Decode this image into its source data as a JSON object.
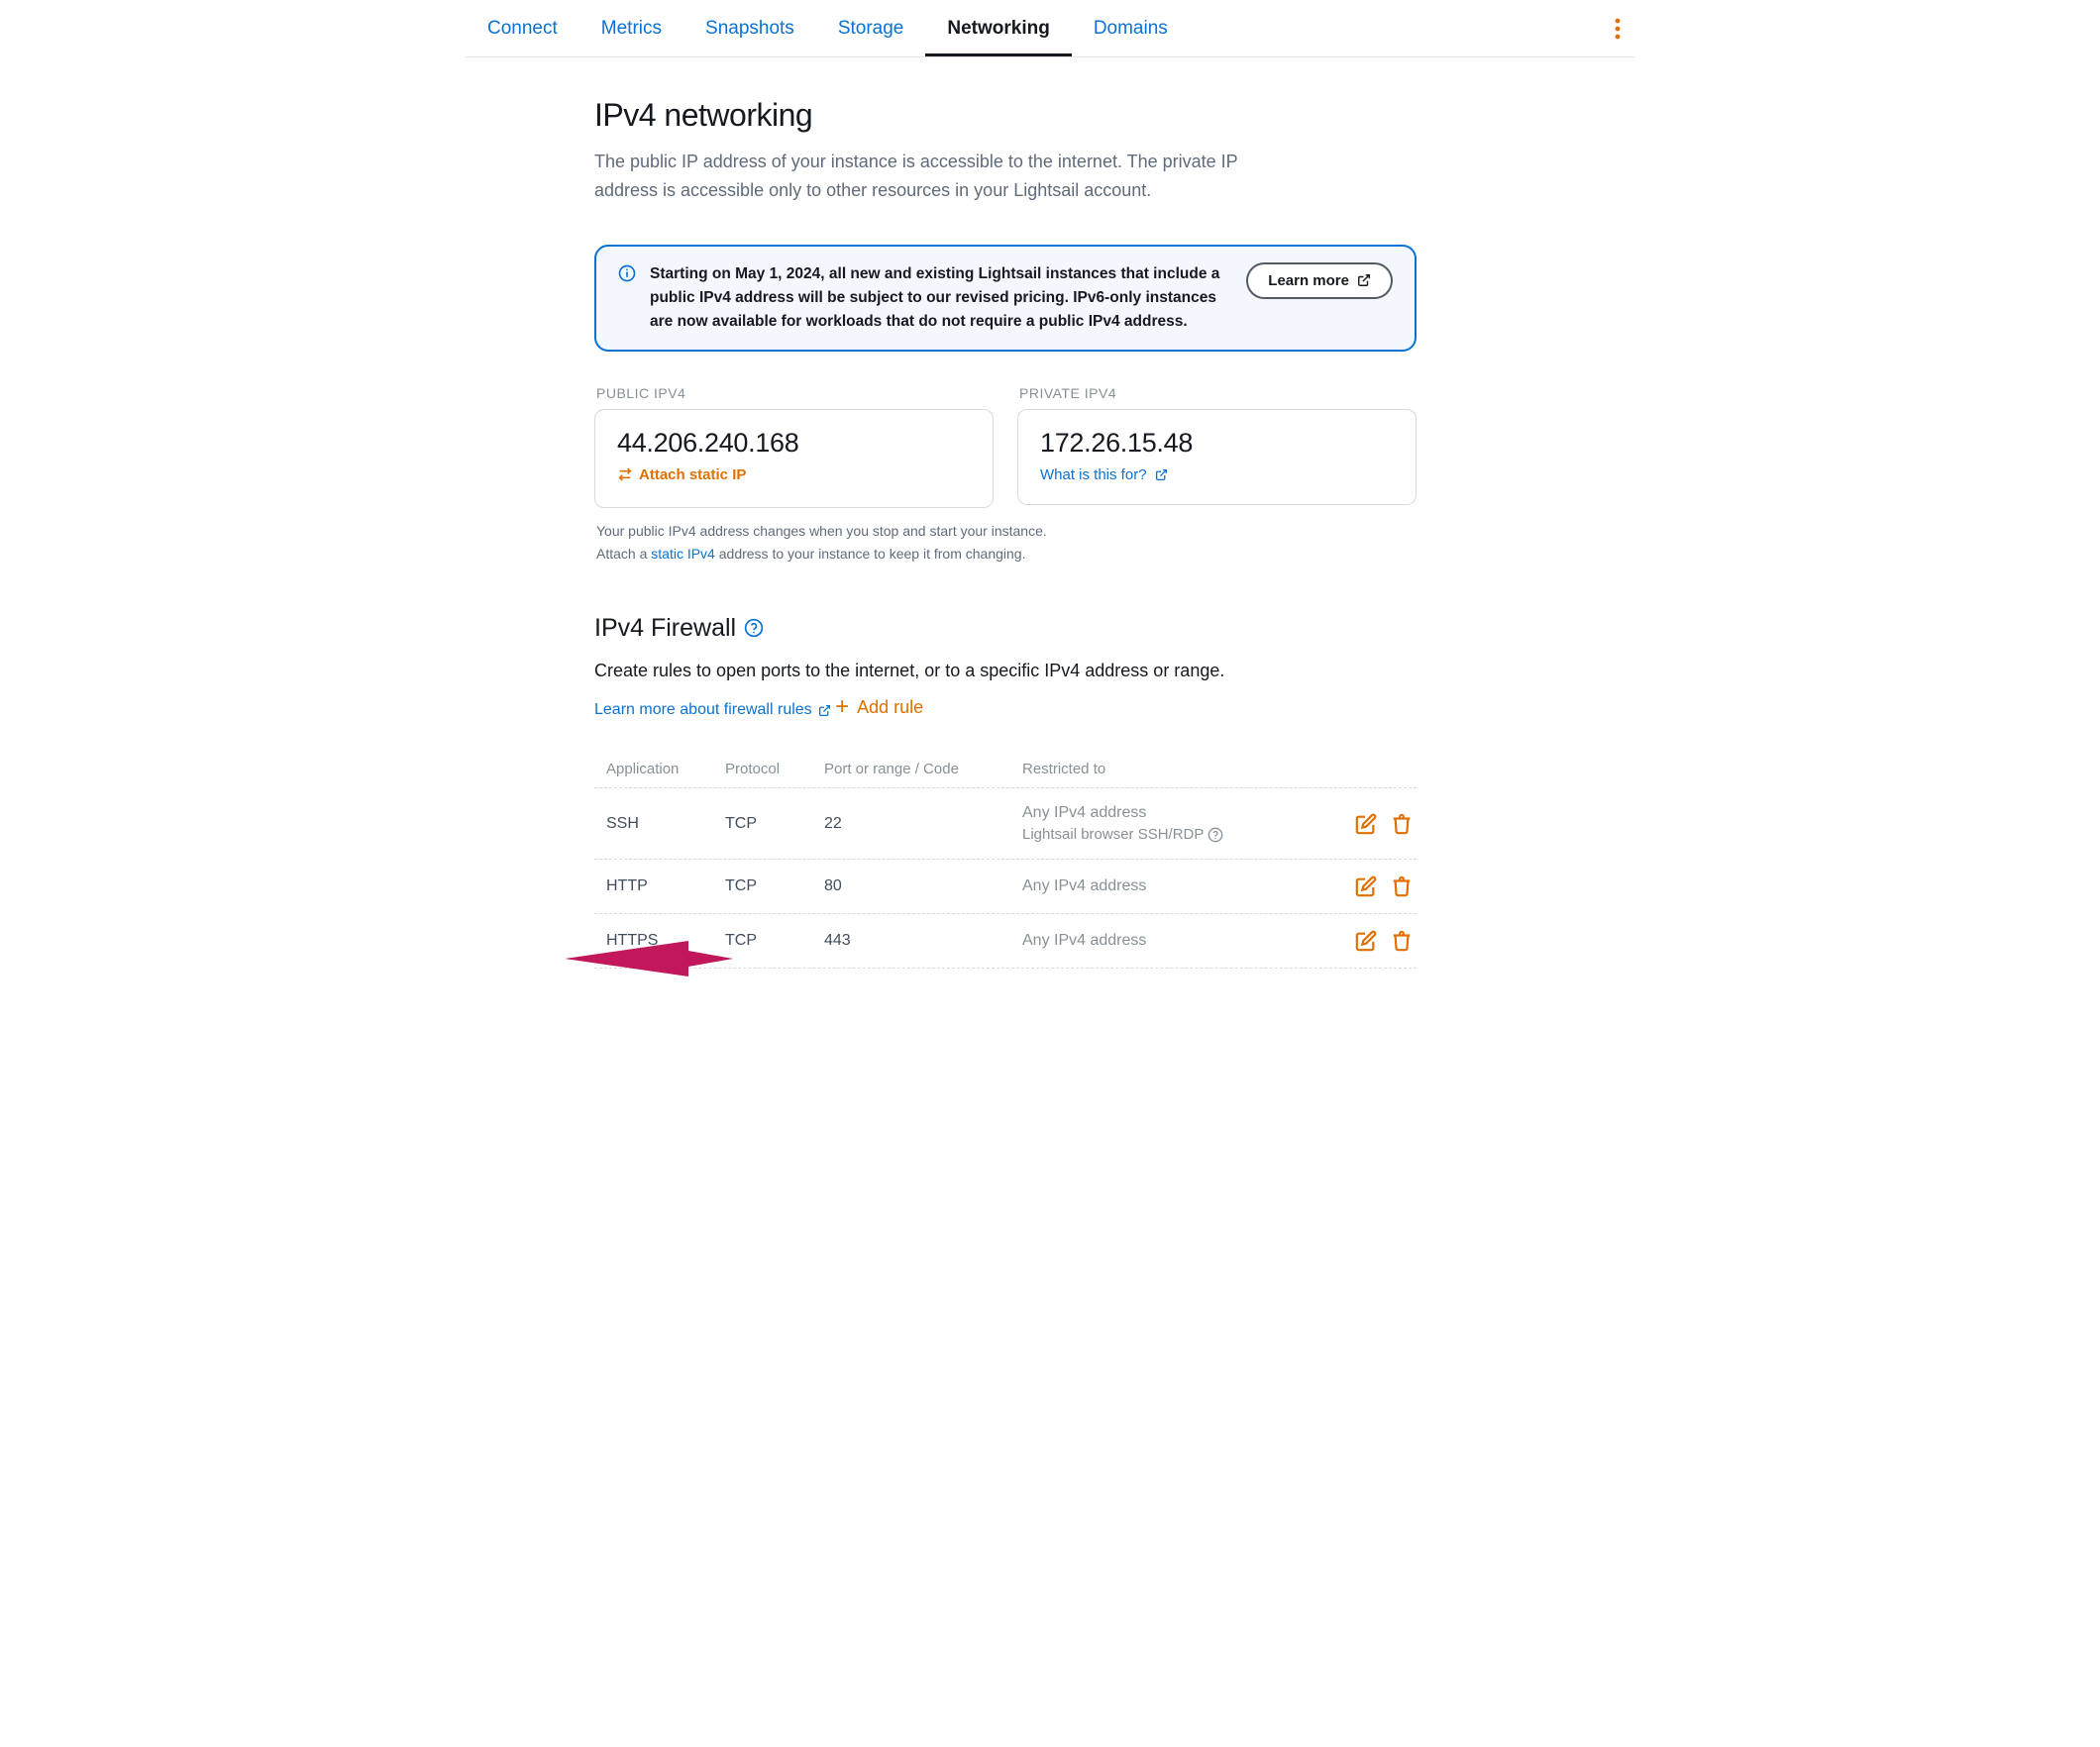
{
  "tabs": [
    "Connect",
    "Metrics",
    "Snapshots",
    "Storage",
    "Networking",
    "Domains"
  ],
  "active_tab_index": 4,
  "ipv4": {
    "heading": "IPv4 networking",
    "subtitle": "The public IP address of your instance is accessible to the internet. The private IP address is accessible only to other resources in your Lightsail account."
  },
  "notice": {
    "body": "Starting on May 1, 2024, all new and existing Lightsail instances that include a public IPv4 address will be subject to our revised pricing. IPv6-only instances are now available for workloads that do not require a public IPv4 address.",
    "button": "Learn more"
  },
  "public_ip": {
    "label": "PUBLIC IPV4",
    "value": "44.206.240.168",
    "action": "Attach static IP"
  },
  "private_ip": {
    "label": "PRIVATE IPV4",
    "value": "172.26.15.48",
    "action": "What is this for?"
  },
  "helper": {
    "line1": "Your public IPv4 address changes when you stop and start your instance.",
    "line2_pre": "Attach a ",
    "line2_link": "static IPv4",
    "line2_post": " address to your instance to keep it from changing."
  },
  "firewall": {
    "heading": "IPv4 Firewall",
    "subtitle": "Create rules to open ports to the internet, or to a specific IPv4 address or range.",
    "learn_more": "Learn more about firewall rules",
    "add_rule": "Add rule",
    "columns": {
      "app": "Application",
      "proto": "Protocol",
      "port": "Port or range / Code",
      "restrict": "Restricted to"
    },
    "rows": [
      {
        "app": "SSH",
        "proto": "TCP",
        "port": "22",
        "restrict": "Any IPv4 address",
        "extra": "Lightsail browser SSH/RDP"
      },
      {
        "app": "HTTP",
        "proto": "TCP",
        "port": "80",
        "restrict": "Any IPv4 address"
      },
      {
        "app": "HTTPS",
        "proto": "TCP",
        "port": "443",
        "restrict": "Any IPv4 address"
      }
    ]
  }
}
